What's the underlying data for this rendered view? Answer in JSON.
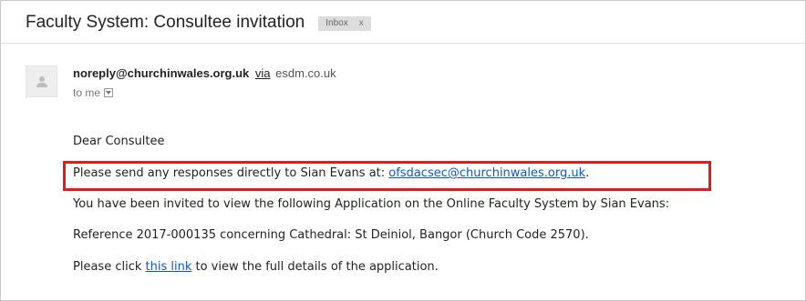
{
  "email": {
    "subject": "Faculty System: Consultee invitation",
    "label_badge": "Inbox",
    "label_badge_close": "x",
    "sender_email": "noreply@churchinwales.org.uk",
    "via_label": "via",
    "via_domain": "esdm.co.uk",
    "recipient_line": "to me",
    "body": {
      "greeting": "Dear Consultee",
      "responses_prefix": "Please send any responses directly to Sian Evans at: ",
      "responses_email": "ofsdacsec@churchinwales.org.uk",
      "responses_suffix": ".",
      "invitation": "You have been invited to view the following Application on the Online Faculty System by Sian Evans:",
      "reference": "Reference 2017-000135 concerning Cathedral: St Deiniol, Bangor (Church Code 2570).",
      "click_prefix": "Please click ",
      "click_link": "this link",
      "click_suffix": " to view the full details of the application."
    }
  },
  "colors": {
    "link": "#1155cc",
    "highlight": "#e8191b",
    "badge_bg": "#dddddd"
  },
  "icons": {
    "avatar": "person-silhouette-icon",
    "toggle": "chevron-down-icon"
  }
}
